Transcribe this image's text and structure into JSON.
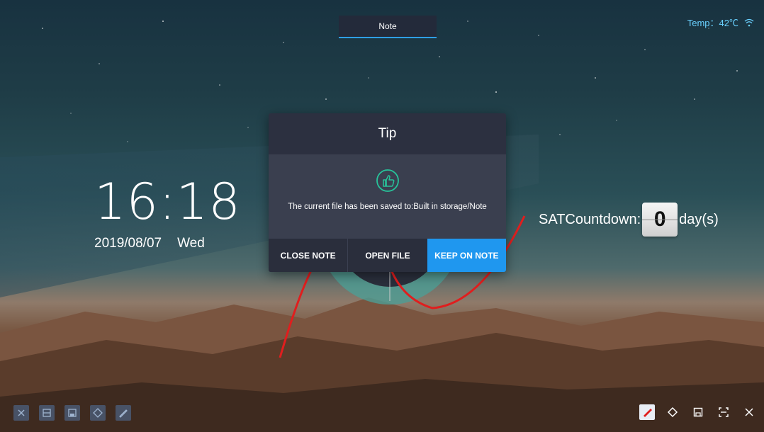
{
  "note_tab": {
    "label": "Note"
  },
  "status": {
    "temperature": "Temp：42℃",
    "wifi_icon": "wifi-icon"
  },
  "clock": {
    "time": "16:18",
    "date": "2019/08/07",
    "weekday": "Wed"
  },
  "countdown": {
    "label": "SATCountdown:",
    "value": "0",
    "unit": "day(s)"
  },
  "dialog": {
    "title": "Tip",
    "icon": "thumbs-up-icon",
    "message": "The current file has been saved to:Built in storage/Note",
    "buttons": {
      "close": "CLOSE NOTE",
      "open": "OPEN FILE",
      "keep": "KEEP ON NOTE"
    }
  },
  "toolbar_left": [
    "close-icon",
    "minimize-icon",
    "save-icon",
    "eraser-icon",
    "pen-icon"
  ],
  "toolbar_right": [
    "pen-icon",
    "eraser-icon",
    "save-icon",
    "screenshot-icon",
    "close-icon"
  ],
  "colors": {
    "accent": "#1f97ef",
    "ink": "#e01e1e",
    "dialog": "#3a3f4f",
    "temp": "#6ad1ff"
  }
}
